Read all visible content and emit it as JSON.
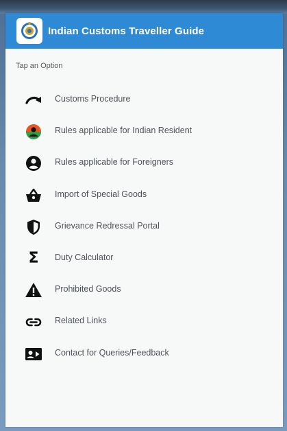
{
  "app": {
    "title": "Indian Customs Traveller Guide",
    "logo_icon": "customs-emblem-icon"
  },
  "prompt": "Tap an Option",
  "menu": [
    {
      "label": "Customs Procedure",
      "icon": "redo-arrow-icon"
    },
    {
      "label": "Rules applicable for Indian Resident",
      "icon": "resident-account-icon"
    },
    {
      "label": "Rules applicable for Foreigners",
      "icon": "account-circle-icon"
    },
    {
      "label": "Import of Special Goods",
      "icon": "shopping-basket-icon"
    },
    {
      "label": "Grievance Redressal Portal",
      "icon": "shield-icon"
    },
    {
      "label": "Duty Calculator",
      "icon": "sigma-icon"
    },
    {
      "label": "Prohibited Goods",
      "icon": "warning-icon"
    },
    {
      "label": "Related Links",
      "icon": "link-icon"
    },
    {
      "label": "Contact for Queries/Feedback",
      "icon": "contact-card-icon"
    }
  ],
  "colors": {
    "appbar": "#2f8ad6",
    "resident_icon_top": "#e8531e",
    "resident_icon_bottom": "#2e9e47"
  },
  "duty_calculator_symbol": "Σ"
}
